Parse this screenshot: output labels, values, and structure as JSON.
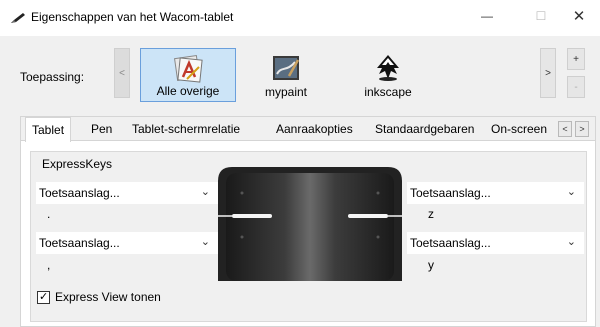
{
  "window": {
    "title": "Eigenschappen van het Wacom-tablet",
    "controls": {
      "minimize": "—",
      "maximize": "☐",
      "close": "✕"
    }
  },
  "applications": {
    "label": "Toepassing:",
    "scroll_left": "<",
    "scroll_right": ">",
    "add": "+",
    "remove": "-",
    "items": [
      {
        "label": "Alle overige",
        "icon": "all-apps-icon",
        "selected": true
      },
      {
        "label": "mypaint",
        "icon": "mypaint-icon",
        "selected": false
      },
      {
        "label": "inkscape",
        "icon": "inkscape-icon",
        "selected": false
      }
    ]
  },
  "tabs": {
    "items": [
      "Tablet",
      "Pen",
      "Tablet-schermrelatie",
      "Aanraakopties",
      "Standaardgebaren",
      "On-screen"
    ],
    "active": "Tablet",
    "scroll_left": "<",
    "scroll_right": ">"
  },
  "expresskeys": {
    "group_label": "ExpressKeys",
    "keys": [
      {
        "position": "top-left",
        "setting": "Toetsaanslag...",
        "value": "."
      },
      {
        "position": "top-right",
        "setting": "Toetsaanslag...",
        "value": "z"
      },
      {
        "position": "bottom-left",
        "setting": "Toetsaanslag...",
        "value": ","
      },
      {
        "position": "bottom-right",
        "setting": "Toetsaanslag...",
        "value": "y"
      }
    ],
    "dropdown_chevron": "⌄",
    "express_view": {
      "label": "Express View tonen",
      "checked": true,
      "mark": "✓"
    }
  }
}
